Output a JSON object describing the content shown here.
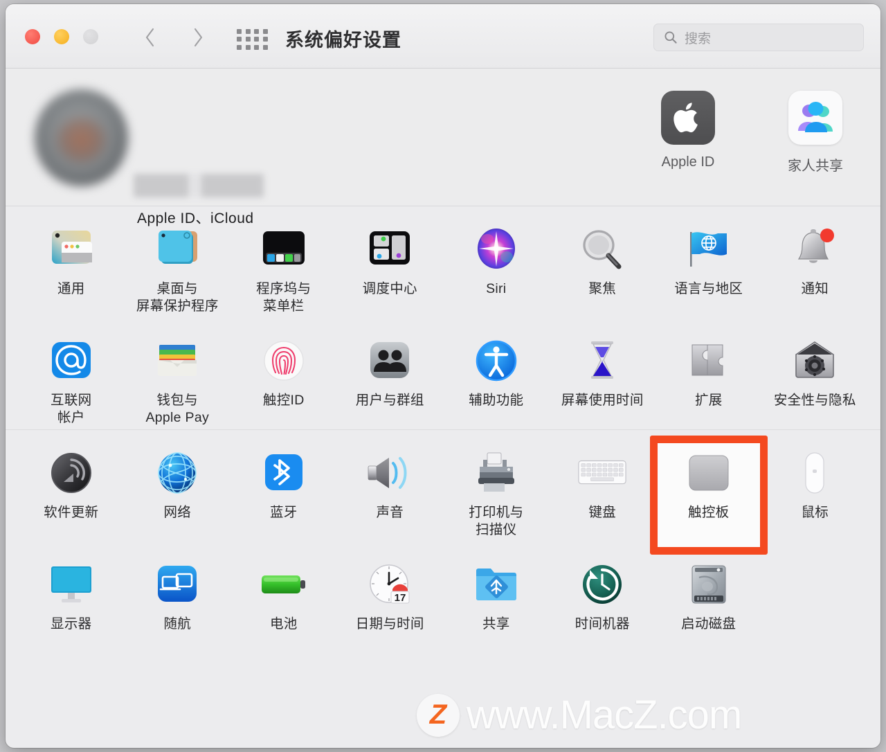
{
  "window": {
    "title": "系统偏好设置",
    "traffic_lights": [
      "close",
      "minimize",
      "zoom"
    ],
    "nav": {
      "back": "‹",
      "forward": "›",
      "grid": "show-all-grid"
    }
  },
  "search": {
    "placeholder": "搜索",
    "icon": "search-icon",
    "value": ""
  },
  "account": {
    "name_redacted": "",
    "subtitle": "Apple ID、iCloud",
    "avatar": "user-avatar",
    "tiles": [
      {
        "label": "Apple ID",
        "icon": "apple-logo-icon"
      },
      {
        "label": "家人共享",
        "icon": "family-sharing-icon"
      }
    ]
  },
  "sections": [
    {
      "name": "personal",
      "rows": [
        [
          {
            "label": "通用",
            "icon": "general-icon"
          },
          {
            "label": "桌面与\n屏幕保护程序",
            "icon": "desktop-screensaver-icon"
          },
          {
            "label": "程序坞与\n菜单栏",
            "icon": "dock-menubar-icon"
          },
          {
            "label": "调度中心",
            "icon": "mission-control-icon"
          },
          {
            "label": "Siri",
            "icon": "siri-icon"
          },
          {
            "label": "聚焦",
            "icon": "spotlight-icon"
          },
          {
            "label": "语言与地区",
            "icon": "language-region-icon"
          },
          {
            "label": "通知",
            "icon": "notifications-icon"
          }
        ],
        [
          {
            "label": "互联网\n帐户",
            "icon": "internet-accounts-icon"
          },
          {
            "label": "钱包与\nApple Pay",
            "icon": "wallet-applepay-icon"
          },
          {
            "label": "触控ID",
            "icon": "touch-id-icon"
          },
          {
            "label": "用户与群组",
            "icon": "users-groups-icon"
          },
          {
            "label": "辅助功能",
            "icon": "accessibility-icon"
          },
          {
            "label": "屏幕使用时间",
            "icon": "screen-time-icon"
          },
          {
            "label": "扩展",
            "icon": "extensions-icon"
          },
          {
            "label": "安全性与隐私",
            "icon": "security-privacy-icon"
          }
        ]
      ]
    },
    {
      "name": "hardware",
      "rows": [
        [
          {
            "label": "软件更新",
            "icon": "software-update-icon"
          },
          {
            "label": "网络",
            "icon": "network-icon"
          },
          {
            "label": "蓝牙",
            "icon": "bluetooth-icon"
          },
          {
            "label": "声音",
            "icon": "sound-icon"
          },
          {
            "label": "打印机与\n扫描仪",
            "icon": "printers-scanners-icon"
          },
          {
            "label": "键盘",
            "icon": "keyboard-icon"
          },
          {
            "label": "触控板",
            "icon": "trackpad-icon",
            "highlighted": true
          },
          {
            "label": "鼠标",
            "icon": "mouse-icon"
          }
        ],
        [
          {
            "label": "显示器",
            "icon": "displays-icon"
          },
          {
            "label": "随航",
            "icon": "sidecar-icon"
          },
          {
            "label": "电池",
            "icon": "battery-icon"
          },
          {
            "label": "日期与时间",
            "icon": "date-time-icon",
            "badge": "17"
          },
          {
            "label": "共享",
            "icon": "sharing-icon"
          },
          {
            "label": "时间机器",
            "icon": "time-machine-icon"
          },
          {
            "label": "启动磁盘",
            "icon": "startup-disk-icon"
          },
          {
            "label": "",
            "icon": ""
          }
        ]
      ]
    }
  ],
  "watermark": {
    "logo": "Z",
    "text": "www.MacZ.com"
  },
  "colors": {
    "highlight": "#f4491f",
    "accent_blue": "#0a84ff"
  }
}
